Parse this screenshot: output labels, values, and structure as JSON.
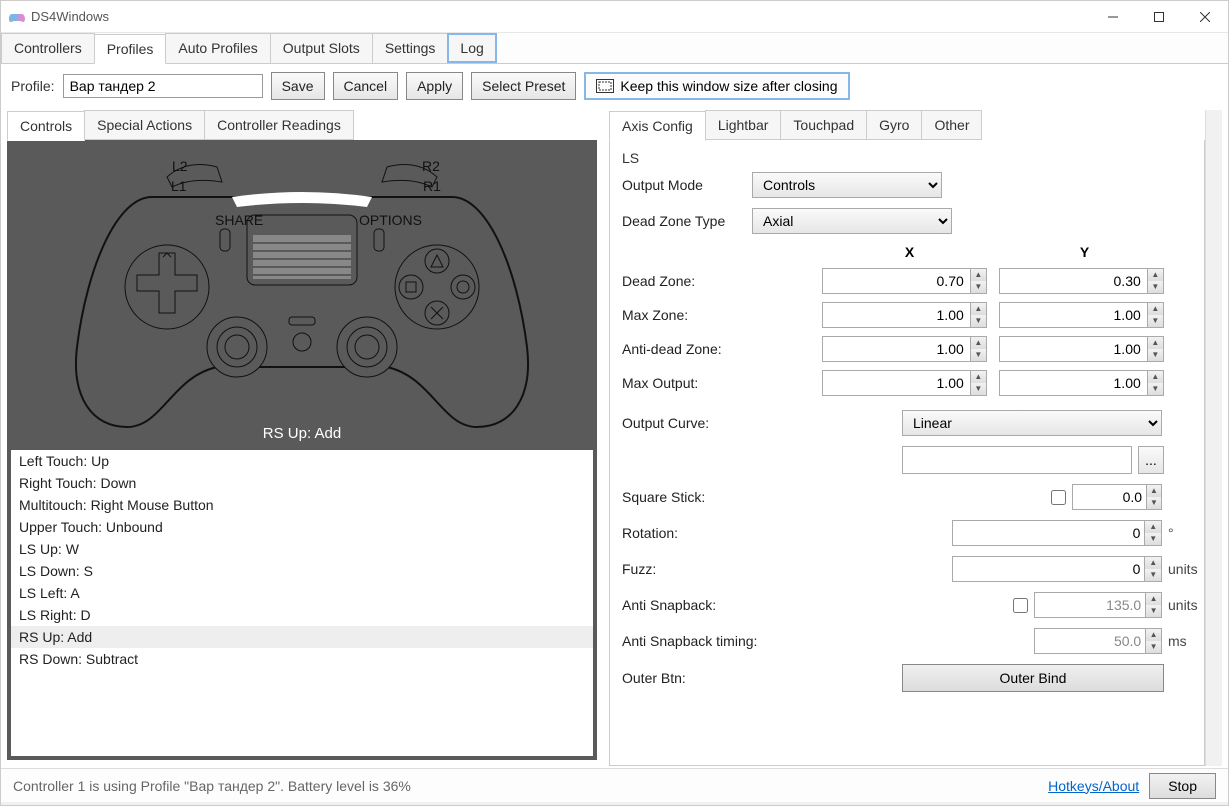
{
  "window": {
    "title": "DS4Windows"
  },
  "tabs": {
    "main": [
      "Controllers",
      "Profiles",
      "Auto Profiles",
      "Output Slots",
      "Settings",
      "Log"
    ],
    "main_active": 1,
    "sub_left": [
      "Controls",
      "Special Actions",
      "Controller Readings"
    ],
    "sub_left_active": 0,
    "sub_right": [
      "Axis Config",
      "Lightbar",
      "Touchpad",
      "Gyro",
      "Other"
    ],
    "sub_right_active": 0
  },
  "toolbar": {
    "profile_label": "Profile:",
    "profile_value": "Вар тандер 2",
    "save": "Save",
    "cancel": "Cancel",
    "apply": "Apply",
    "select_preset": "Select Preset",
    "keep_window": "Keep this window size after closing"
  },
  "controller": {
    "hint": "RS Up: Add",
    "labels": {
      "l2": "L2",
      "l1": "L1",
      "r2": "R2",
      "r1": "R1",
      "share": "SHARE",
      "options": "OPTIONS"
    }
  },
  "mappings": [
    "Left Touch: Up",
    "Right Touch: Down",
    "Multitouch: Right Mouse Button",
    "Upper Touch: Unbound",
    "LS Up: W",
    "LS Down: S",
    "LS Left: A",
    "LS Right: D",
    "RS Up: Add",
    "RS Down: Subtract"
  ],
  "mappings_selected": 8,
  "axis": {
    "group": "LS",
    "output_mode_label": "Output Mode",
    "output_mode_value": "Controls",
    "dead_zone_type_label": "Dead Zone Type",
    "dead_zone_type_value": "Axial",
    "col_x": "X",
    "col_y": "Y",
    "dead_zone_label": "Dead Zone:",
    "dead_zone_x": "0.70",
    "dead_zone_y": "0.30",
    "max_zone_label": "Max Zone:",
    "max_zone_x": "1.00",
    "max_zone_y": "1.00",
    "anti_dead_label": "Anti-dead Zone:",
    "anti_dead_x": "1.00",
    "anti_dead_y": "1.00",
    "max_output_label": "Max Output:",
    "max_output_x": "1.00",
    "max_output_y": "1.00",
    "output_curve_label": "Output Curve:",
    "output_curve_value": "Linear",
    "ellipsis": "...",
    "square_stick_label": "Square Stick:",
    "square_stick_value": "0.0",
    "rotation_label": "Rotation:",
    "rotation_value": "0",
    "rotation_unit": "°",
    "fuzz_label": "Fuzz:",
    "fuzz_value": "0",
    "fuzz_unit": "units",
    "anti_snapback_label": "Anti Snapback:",
    "anti_snapback_value": "135.0",
    "anti_snapback_unit": "units",
    "anti_snapback_timing_label": "Anti Snapback timing:",
    "anti_snapback_timing_value": "50.0",
    "anti_snapback_timing_unit": "ms",
    "outer_btn_label": "Outer Btn:",
    "outer_bind": "Outer Bind"
  },
  "status": {
    "text": "Controller 1 is using Profile \"Вар тандер 2\". Battery level is 36%",
    "hotkeys": "Hotkeys/About",
    "stop": "Stop"
  }
}
